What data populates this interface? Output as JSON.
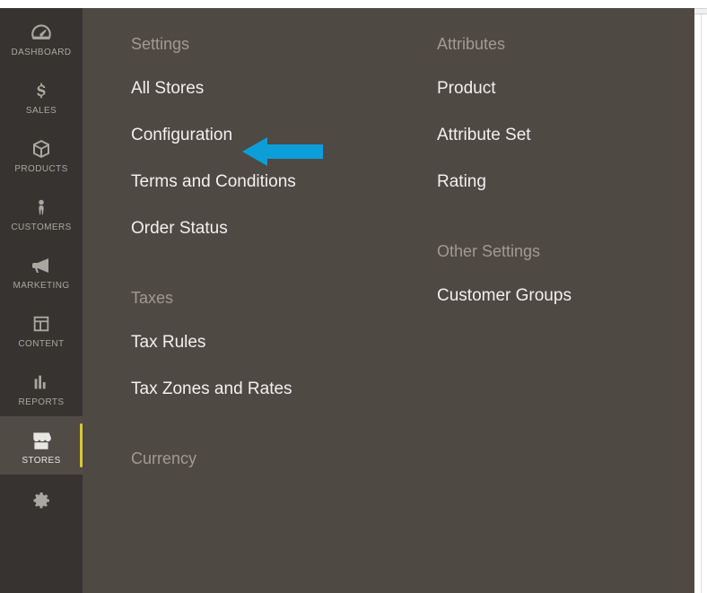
{
  "sidebar": {
    "items": [
      {
        "label": "DASHBOARD"
      },
      {
        "label": "SALES"
      },
      {
        "label": "PRODUCTS"
      },
      {
        "label": "CUSTOMERS"
      },
      {
        "label": "MARKETING"
      },
      {
        "label": "CONTENT"
      },
      {
        "label": "REPORTS"
      },
      {
        "label": "STORES"
      }
    ]
  },
  "flyout": {
    "left": {
      "settings_title": "Settings",
      "settings_items": [
        "All Stores",
        "Configuration",
        "Terms and Conditions",
        "Order Status"
      ],
      "taxes_title": "Taxes",
      "taxes_items": [
        "Tax Rules",
        "Tax Zones and Rates"
      ],
      "currency_title": "Currency"
    },
    "right": {
      "attributes_title": "Attributes",
      "attributes_items": [
        "Product",
        "Attribute Set",
        "Rating"
      ],
      "other_title": "Other Settings",
      "other_items": [
        "Customer Groups"
      ]
    }
  }
}
